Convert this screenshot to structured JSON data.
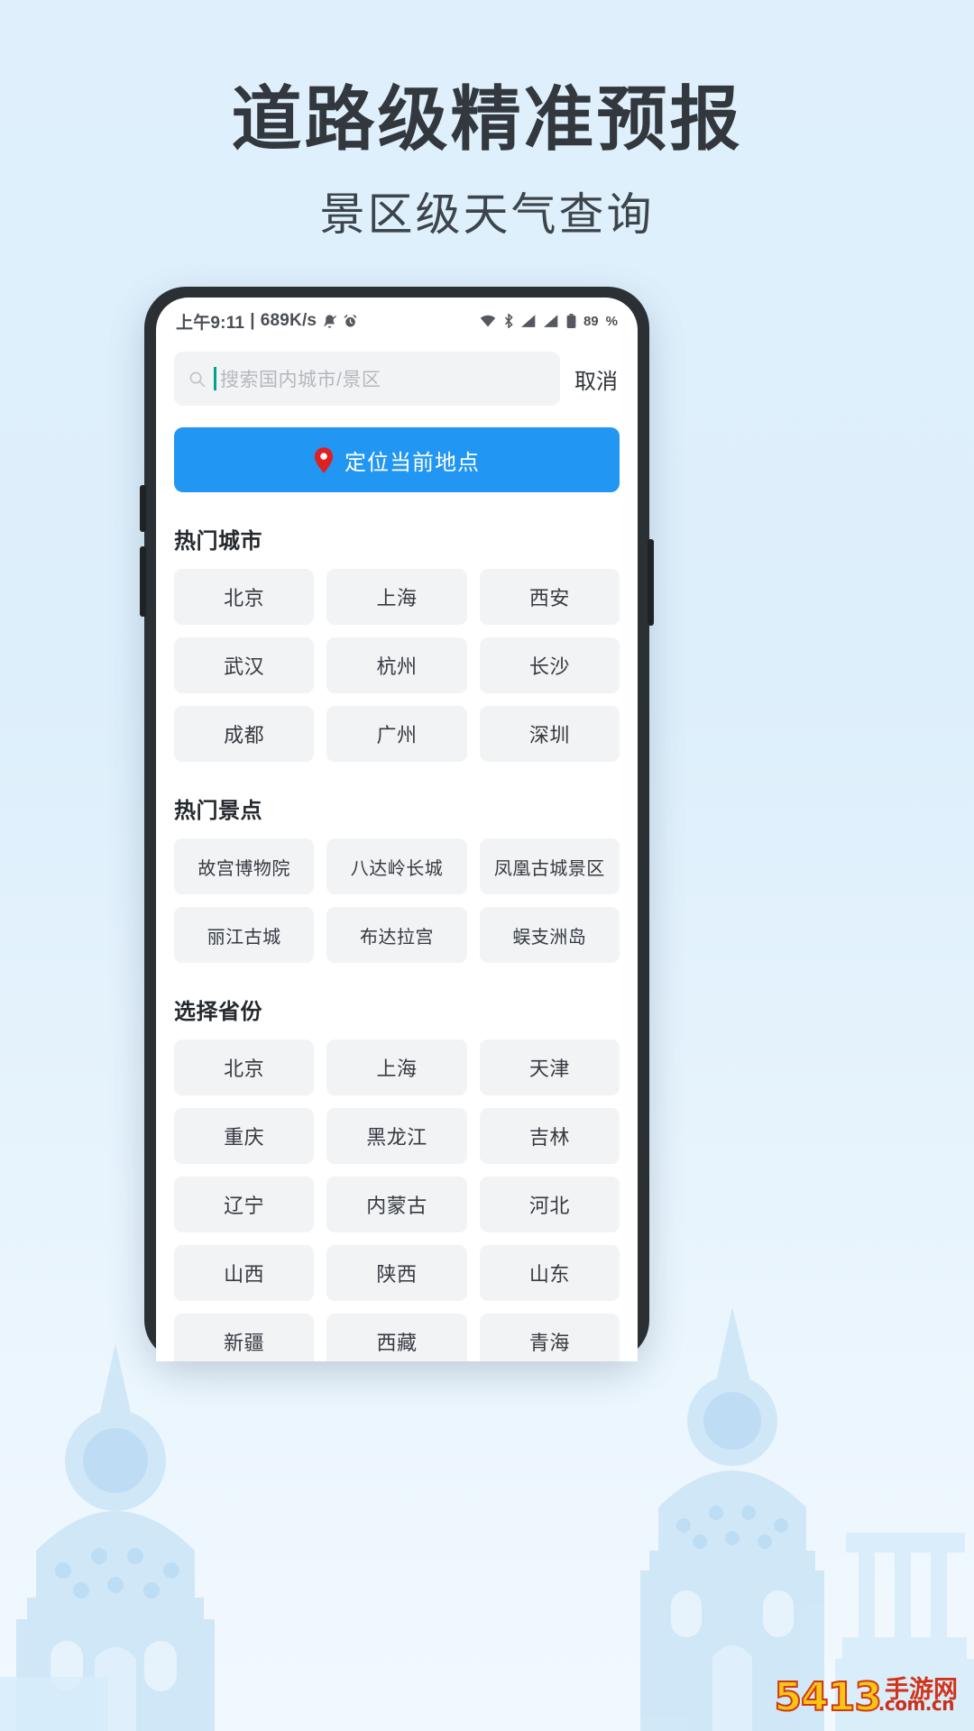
{
  "promo": {
    "title": "道路级精准预报",
    "subtitle": "景区级天气查询"
  },
  "statusbar": {
    "time": "上午9:11",
    "separator": "|",
    "network_speed": "689K/s",
    "mute_icon": "mute-bell-icon",
    "alarm_icon": "alarm-clock-icon",
    "wifi_icon": "wifi-icon",
    "bluetooth_icon": "bluetooth-icon",
    "signal_icon": "signal-bars-icon",
    "sim_icon": "sim-signal-icon",
    "battery_icon": "battery-icon",
    "battery_level": "89",
    "battery_unit": "%"
  },
  "search": {
    "icon": "search-icon",
    "placeholder": "搜索国内城市/景区",
    "value": "",
    "cancel_label": "取消"
  },
  "locate": {
    "icon": "map-pin-icon",
    "label": "定位当前地点",
    "color": "#2196f3",
    "pin_color": "#e02020"
  },
  "hot_cities": {
    "title": "热门城市",
    "items": [
      "北京",
      "上海",
      "西安",
      "武汉",
      "杭州",
      "长沙",
      "成都",
      "广州",
      "深圳"
    ]
  },
  "hot_spots": {
    "title": "热门景点",
    "items": [
      "故宫博物院",
      "八达岭长城",
      "凤凰古城景区",
      "丽江古城",
      "布达拉宫",
      "蜈支洲岛"
    ]
  },
  "provinces": {
    "title": "选择省份",
    "items": [
      "北京",
      "上海",
      "天津",
      "重庆",
      "黑龙江",
      "吉林",
      "辽宁",
      "内蒙古",
      "河北",
      "山西",
      "陕西",
      "山东",
      "新疆",
      "西藏",
      "青海"
    ]
  },
  "watermark": {
    "number": "5413",
    "cn": "手游网",
    "domain": ".com.cn"
  },
  "colors": {
    "page_bg": "#dff0fc",
    "accent": "#2196f3",
    "chip_bg": "#f2f3f5",
    "title_text": "#32383d",
    "caret": "#00a38c"
  }
}
